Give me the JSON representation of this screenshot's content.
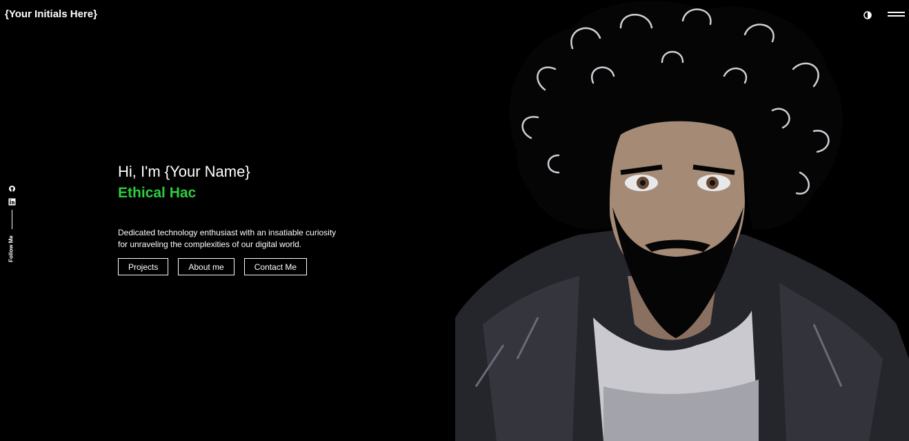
{
  "header": {
    "brand": "{Your Initials Here}",
    "theme_icon": "half-circle-contrast-icon",
    "menu_icon": "hamburger-menu-icon"
  },
  "social": {
    "icons": [
      "github-icon",
      "linkedin-icon"
    ],
    "follow_label": "Follow Me"
  },
  "hero": {
    "greeting": "Hi, I'm {Your Name}",
    "role": "Ethical Hac",
    "description": "Dedicated technology enthusiast with an insatiable curiosity for unraveling the complexities of our digital world.",
    "buttons": {
      "projects": "Projects",
      "about": "About me",
      "contact": "Contact Me"
    }
  },
  "colors": {
    "background": "#000000",
    "accent": "#2ecc40",
    "text": "#ffffff"
  }
}
